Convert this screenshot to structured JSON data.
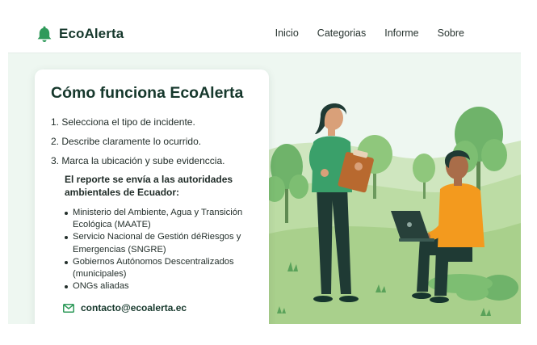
{
  "brand": {
    "name": "EcoAlerta",
    "icon": "bell-icon",
    "color": "#2f9a5a"
  },
  "nav": {
    "links": [
      "Inicio",
      "Categorias",
      "Informe",
      "Sobre"
    ]
  },
  "card": {
    "title": "Cómo funciona EcoAlerta",
    "steps": [
      "1.  Selecciona el tipo de incidente.",
      "2.  Describe claramente lo ocurrido.",
      "3.  Marca la ubicación y sube evidenccia."
    ],
    "report_note": "El reporte se envía a las autoridades ambientales de Ecuador:",
    "authorities": [
      "Ministerio del Ambiente, Agua y Transición Ecológica (MAATE)",
      "Servicio Nacional de Gestión déRiesgos y Emergencias (SNGRE)",
      "Gobiernos Autónomos Descentralizados (municipales)",
      "ONGs aliadas"
    ],
    "contact_icon": "mail-icon",
    "contact_email": "contacto@ecoalerta.ec"
  },
  "colors": {
    "accent": "#2f9a5a",
    "title": "#16382c",
    "hero_bg": "#eef7f1",
    "grass": "#a9d08c"
  }
}
